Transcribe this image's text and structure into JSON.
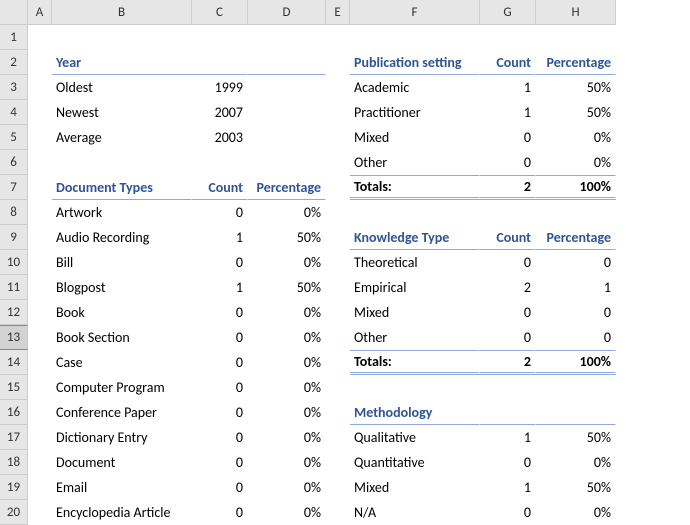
{
  "cols": [
    "A",
    "B",
    "C",
    "D",
    "E",
    "F",
    "G",
    "H"
  ],
  "rows": [
    "1",
    "2",
    "3",
    "4",
    "5",
    "6",
    "7",
    "8",
    "9",
    "10",
    "11",
    "12",
    "13",
    "14",
    "15",
    "16",
    "17",
    "18",
    "19",
    "20"
  ],
  "year": {
    "title": "Year",
    "oldest_label": "Oldest",
    "oldest": "1999",
    "newest_label": "Newest",
    "newest": "2007",
    "average_label": "Average",
    "average": "2003"
  },
  "doc": {
    "title": "Document Types",
    "count_h": "Count",
    "pct_h": "Percentage",
    "rows": [
      {
        "label": "Artwork",
        "count": "0",
        "pct": "0%"
      },
      {
        "label": "Audio Recording",
        "count": "1",
        "pct": "50%"
      },
      {
        "label": "Bill",
        "count": "0",
        "pct": "0%"
      },
      {
        "label": "Blogpost",
        "count": "1",
        "pct": "50%"
      },
      {
        "label": "Book",
        "count": "0",
        "pct": "0%"
      },
      {
        "label": "Book Section",
        "count": "0",
        "pct": "0%"
      },
      {
        "label": "Case",
        "count": "0",
        "pct": "0%"
      },
      {
        "label": "Computer Program",
        "count": "0",
        "pct": "0%"
      },
      {
        "label": "Conference Paper",
        "count": "0",
        "pct": "0%"
      },
      {
        "label": "Dictionary Entry",
        "count": "0",
        "pct": "0%"
      },
      {
        "label": "Document",
        "count": "0",
        "pct": "0%"
      },
      {
        "label": "Email",
        "count": "0",
        "pct": "0%"
      },
      {
        "label": "Encyclopedia Article",
        "count": "0",
        "pct": "0%"
      }
    ]
  },
  "pub": {
    "title": "Publication setting",
    "count_h": "Count",
    "pct_h": "Percentage",
    "rows": [
      {
        "label": "Academic",
        "count": "1",
        "pct": "50%"
      },
      {
        "label": "Practitioner",
        "count": "1",
        "pct": "50%"
      },
      {
        "label": "Mixed",
        "count": "0",
        "pct": "0%"
      },
      {
        "label": "Other",
        "count": "0",
        "pct": "0%"
      }
    ],
    "totals_label": "Totals:",
    "totals_count": "2",
    "totals_pct": "100%"
  },
  "know": {
    "title": "Knowledge Type",
    "count_h": "Count",
    "pct_h": "Percentage",
    "rows": [
      {
        "label": "Theoretical",
        "count": "0",
        "pct": "0"
      },
      {
        "label": "Empirical",
        "count": "2",
        "pct": "1"
      },
      {
        "label": "Mixed",
        "count": "0",
        "pct": "0"
      },
      {
        "label": "Other",
        "count": "0",
        "pct": "0"
      }
    ],
    "totals_label": "Totals:",
    "totals_count": "2",
    "totals_pct": "100%"
  },
  "meth": {
    "title": "Methodology",
    "rows": [
      {
        "label": "Qualitative",
        "count": "1",
        "pct": "50%"
      },
      {
        "label": "Quantitative",
        "count": "0",
        "pct": "0%"
      },
      {
        "label": "Mixed",
        "count": "1",
        "pct": "50%"
      },
      {
        "label": "N/A",
        "count": "0",
        "pct": "0%"
      }
    ]
  }
}
